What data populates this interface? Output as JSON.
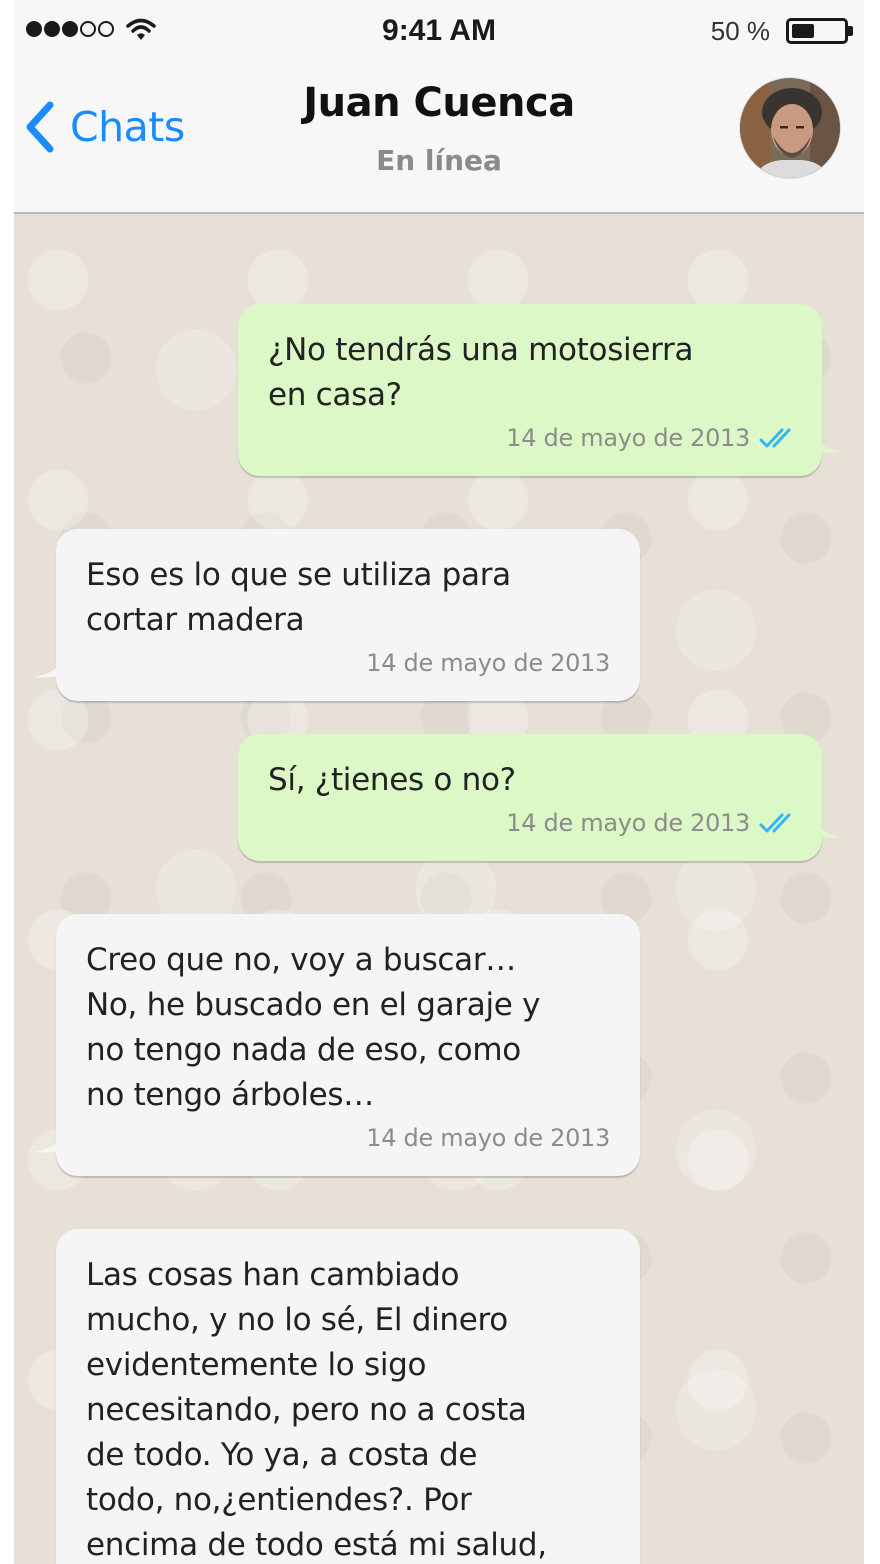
{
  "status_bar": {
    "time": "9:41 AM",
    "battery_text": "50 %",
    "battery_level": 0.5,
    "signal_strength": 3,
    "signal_max": 5,
    "wifi_icon": "wifi-icon"
  },
  "header": {
    "back_label": "Chats",
    "back_icon": "chevron-left-icon",
    "contact_name": "Juan Cuenca",
    "contact_status": "En línea",
    "accent_color": "#1a8cff"
  },
  "messages": [
    {
      "direction": "outgoing",
      "text": "¿No tendrás una motosierra\nen casa?",
      "timestamp": "14 de mayo de 2013",
      "read_ticks": true
    },
    {
      "direction": "incoming",
      "text": "Eso es lo que se utiliza para\ncortar madera",
      "timestamp": "14 de mayo de 2013",
      "read_ticks": false
    },
    {
      "direction": "outgoing",
      "text": "Sí, ¿tienes o no?",
      "timestamp": "14 de mayo de 2013",
      "read_ticks": true
    },
    {
      "direction": "incoming",
      "text": "Creo que no, voy a buscar…\nNo, he buscado en el garaje y\nno tengo nada de eso, como\nno tengo árboles…",
      "timestamp": "14 de mayo de 2013",
      "read_ticks": false
    },
    {
      "direction": "incoming",
      "text": "Las cosas han cambiado\nmucho, y no lo sé, El dinero\nevidentemente lo sigo\nnecesitando, pero no a costa\nde todo. Yo ya, a costa de\ntodo, no,¿entiendes?. Por\nencima de todo está mi salud,",
      "timestamp": "",
      "read_ticks": false
    }
  ],
  "colors": {
    "outgoing_bubble": "#dcf8c6",
    "incoming_bubble": "#f5f5f5",
    "chat_background": "#e6e0d7",
    "read_tick": "#34b7f1"
  }
}
